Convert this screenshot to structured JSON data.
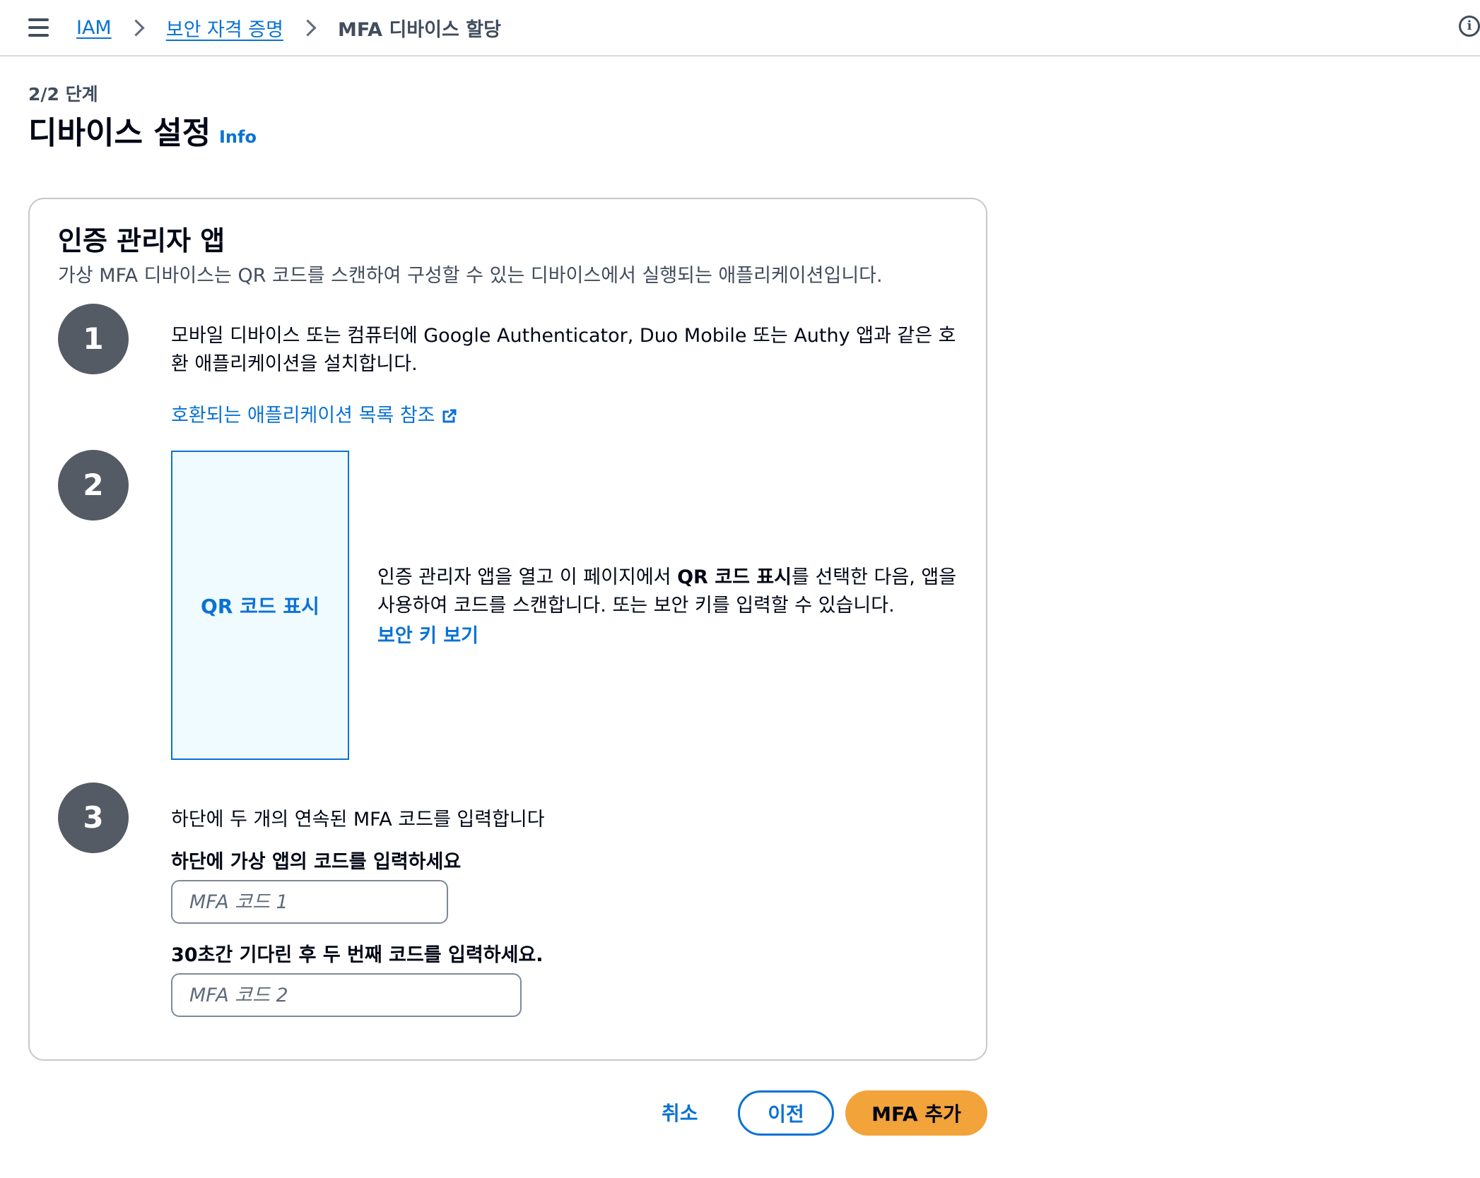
{
  "breadcrumb": {
    "items": [
      "IAM",
      "보안 자격 증명"
    ],
    "current": "MFA 디바이스 할당"
  },
  "header": {
    "step": "2/2 단계",
    "title": "디바이스 설정",
    "info": "Info"
  },
  "card": {
    "title": "인증 관리자 앱",
    "description": "가상 MFA 디바이스는 QR 코드를 스캔하여 구성할 수 있는 디바이스에서 실행되는 애플리케이션입니다."
  },
  "steps": {
    "s1": {
      "number": "1",
      "text": "모바일 디바이스 또는 컴퓨터에 Google Authenticator, Duo Mobile 또는 Authy 앱과 같은 호환 애플리케이션을 설치합니다.",
      "link": "호환되는 애플리케이션 목록 참조"
    },
    "s2": {
      "number": "2",
      "qr_label": "QR 코드 표시",
      "text_before": "인증 관리자 앱을 열고 이 페이지에서 ",
      "text_bold": "QR 코드 표시",
      "text_after": "를 선택한 다음, 앱을 사용하여 코드를 스캔합니다. 또는 보안 키를 입력할 수 있습니다.",
      "link": "보안 키 보기"
    },
    "s3": {
      "number": "3",
      "text": "하단에 두 개의 연속된 MFA 코드를 입력합니다",
      "label1": "하단에 가상 앱의 코드를 입력하세요",
      "placeholder1": "MFA 코드 1",
      "label2": "30초간 기다린 후 두 번째 코드를 입력하세요.",
      "placeholder2": "MFA 코드 2"
    }
  },
  "actions": {
    "cancel": "취소",
    "previous": "이전",
    "submit": "MFA 추가"
  },
  "colors": {
    "link": "#0972d3",
    "primary_button": "#f2a33a",
    "step_circle": "#545b64"
  },
  "icons": {
    "menu": "hamburger-icon",
    "chevron": "chevron-right-icon",
    "info": "info-icon",
    "external": "external-link-icon"
  }
}
